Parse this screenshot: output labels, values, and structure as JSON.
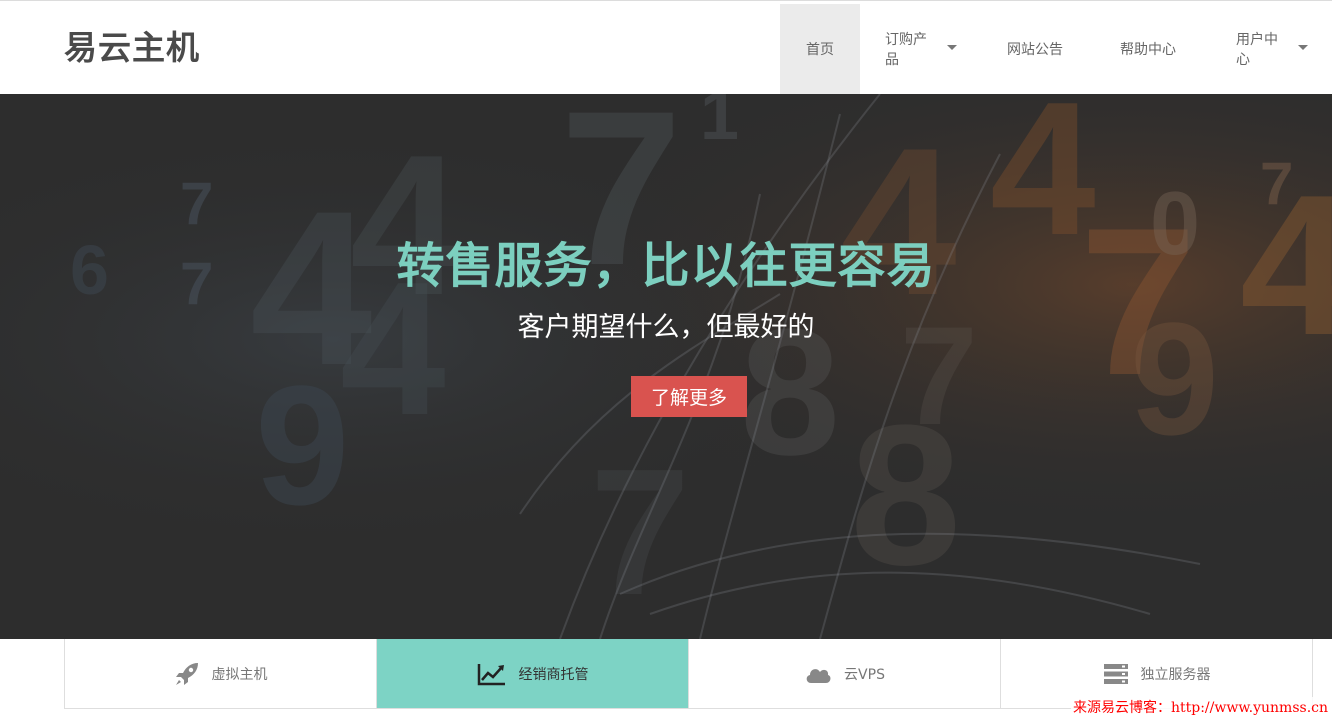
{
  "header": {
    "logo": "易云主机",
    "nav": [
      {
        "label": "首页",
        "active": true,
        "dropdown": false
      },
      {
        "label": "订购产品",
        "active": false,
        "dropdown": true
      },
      {
        "label": "网站公告",
        "active": false,
        "dropdown": false
      },
      {
        "label": "帮助中心",
        "active": false,
        "dropdown": false
      },
      {
        "label": "用户中心",
        "active": false,
        "dropdown": true
      }
    ]
  },
  "hero": {
    "title": "转售服务，比以往更容易",
    "subtitle": "客户期望什么，但最好的",
    "button_label": "了解更多"
  },
  "tabs": [
    {
      "label": "虚拟主机",
      "icon": "rocket-icon",
      "active": false
    },
    {
      "label": "经销商托管",
      "icon": "line-chart-icon",
      "active": true
    },
    {
      "label": "云VPS",
      "icon": "cloud-icon",
      "active": false
    },
    {
      "label": "独立服务器",
      "icon": "server-icon",
      "active": false
    }
  ],
  "watermark": "来源易云博客：http://www.yunmss.cn",
  "colors": {
    "accent": "#7ccfbf",
    "active_tab": "#7dd3c5",
    "button": "#d9534f",
    "hero_bg": "#2e2e2e"
  }
}
